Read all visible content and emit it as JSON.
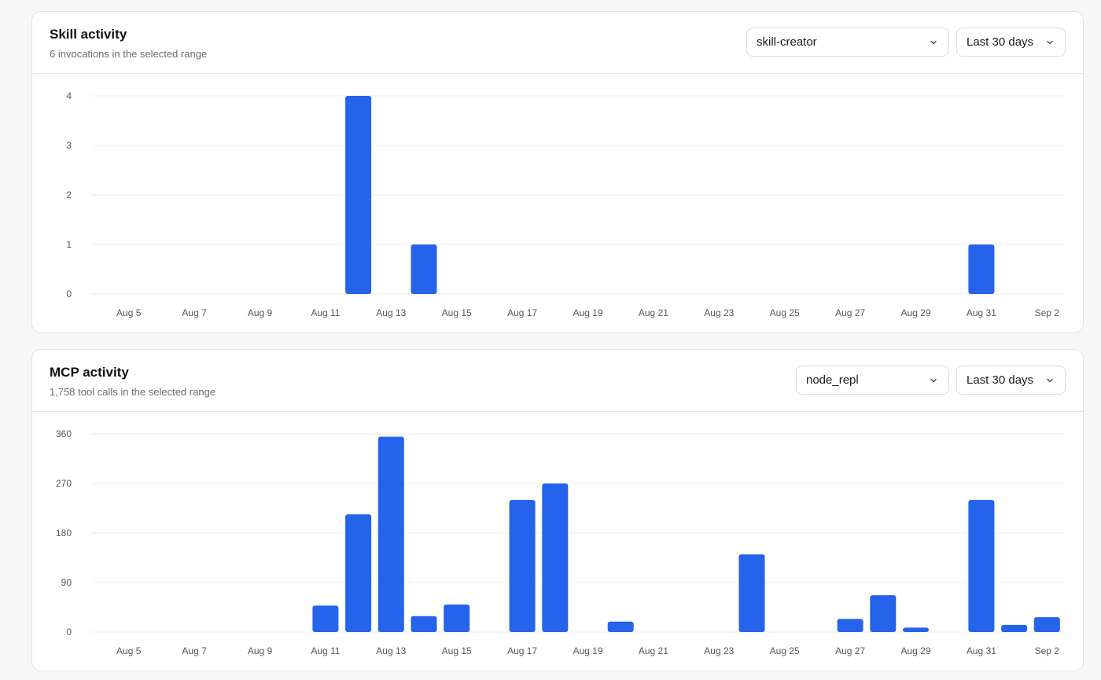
{
  "colors": {
    "bar": "#2563eb",
    "grid": "#ececef",
    "tick": "#555560"
  },
  "skill": {
    "title": "Skill activity",
    "subtitle": "6 invocations in the selected range",
    "filter": {
      "value": "skill-creator",
      "icon": "chevron-down-icon"
    },
    "range": {
      "value": "Last 30 days",
      "icon": "chevron-down-icon"
    }
  },
  "mcp": {
    "title": "MCP activity",
    "subtitle": "1,758 tool calls in the selected range",
    "filter": {
      "value": "node_repl",
      "icon": "chevron-down-icon"
    },
    "range": {
      "value": "Last 30 days",
      "icon": "chevron-down-icon"
    }
  },
  "chart_data": [
    {
      "type": "bar",
      "title": "Skill activity",
      "categories": [
        "Aug 4",
        "Aug 5",
        "Aug 6",
        "Aug 7",
        "Aug 8",
        "Aug 9",
        "Aug 10",
        "Aug 11",
        "Aug 12",
        "Aug 13",
        "Aug 14",
        "Aug 15",
        "Aug 16",
        "Aug 17",
        "Aug 18",
        "Aug 19",
        "Aug 20",
        "Aug 21",
        "Aug 22",
        "Aug 23",
        "Aug 24",
        "Aug 25",
        "Aug 26",
        "Aug 27",
        "Aug 28",
        "Aug 29",
        "Aug 30",
        "Aug 31",
        "Sep 1",
        "Sep 2"
      ],
      "values": [
        0,
        0,
        0,
        0,
        0,
        0,
        0,
        0,
        4,
        0,
        1,
        0,
        0,
        0,
        0,
        0,
        0,
        0,
        0,
        0,
        0,
        0,
        0,
        0,
        0,
        0,
        0,
        1,
        0,
        0
      ],
      "xticks": [
        "Aug 5",
        "Aug 7",
        "Aug 9",
        "Aug 11",
        "Aug 13",
        "Aug 15",
        "Aug 17",
        "Aug 19",
        "Aug 21",
        "Aug 23",
        "Aug 25",
        "Aug 27",
        "Aug 29",
        "Aug 31",
        "Sep 2"
      ],
      "yticks": [
        0,
        1,
        2,
        3,
        4
      ],
      "ylim": [
        0,
        4
      ],
      "grid": true
    },
    {
      "type": "bar",
      "title": "MCP activity",
      "categories": [
        "Aug 4",
        "Aug 5",
        "Aug 6",
        "Aug 7",
        "Aug 8",
        "Aug 9",
        "Aug 10",
        "Aug 11",
        "Aug 12",
        "Aug 13",
        "Aug 14",
        "Aug 15",
        "Aug 16",
        "Aug 17",
        "Aug 18",
        "Aug 19",
        "Aug 20",
        "Aug 21",
        "Aug 22",
        "Aug 23",
        "Aug 24",
        "Aug 25",
        "Aug 26",
        "Aug 27",
        "Aug 28",
        "Aug 29",
        "Aug 30",
        "Aug 31",
        "Sep 1",
        "Sep 2"
      ],
      "values": [
        0,
        0,
        0,
        0,
        0,
        0,
        0,
        48,
        214,
        355,
        29,
        50,
        0,
        240,
        270,
        0,
        19,
        0,
        0,
        0,
        141,
        0,
        0,
        24,
        67,
        8,
        0,
        240,
        13,
        27
      ],
      "xticks": [
        "Aug 5",
        "Aug 7",
        "Aug 9",
        "Aug 11",
        "Aug 13",
        "Aug 15",
        "Aug 17",
        "Aug 19",
        "Aug 21",
        "Aug 23",
        "Aug 25",
        "Aug 27",
        "Aug 29",
        "Aug 31",
        "Sep 2"
      ],
      "yticks": [
        0,
        90,
        180,
        270,
        360
      ],
      "ylim": [
        0,
        360
      ],
      "grid": true
    }
  ]
}
